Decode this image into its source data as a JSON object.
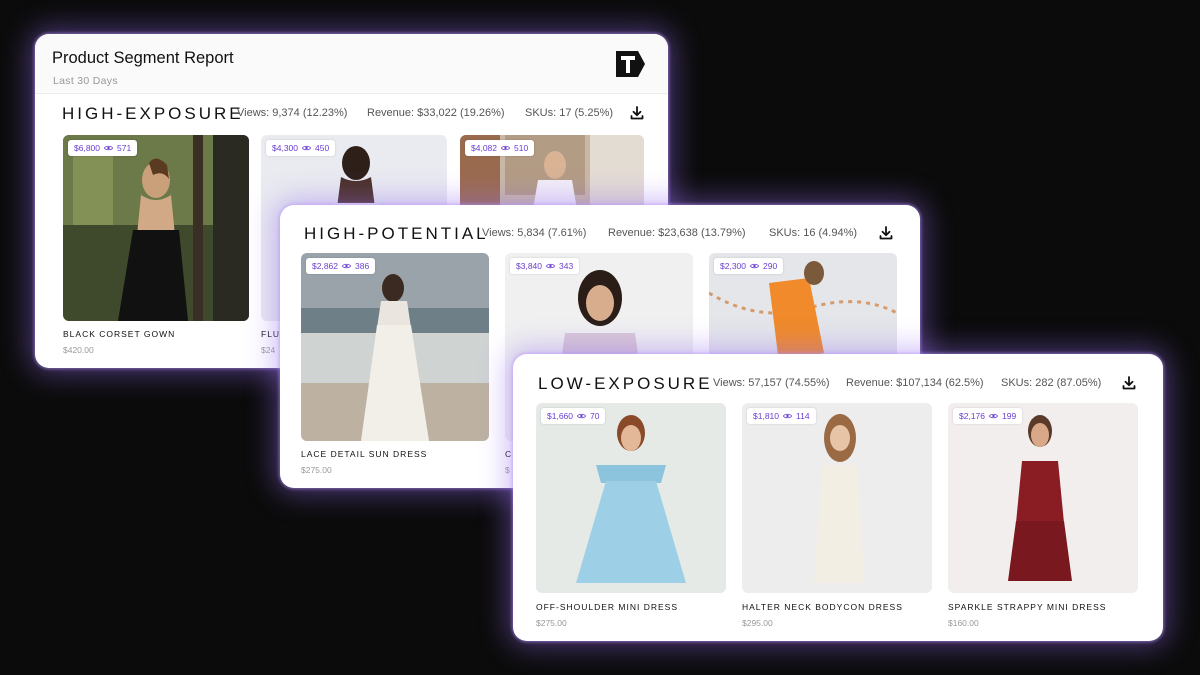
{
  "report": {
    "title": "Product Segment Report",
    "subtitle": "Last 30 Days",
    "logo_icon": "t-logo-icon"
  },
  "segments": {
    "high_exposure": {
      "title": "HIGH-EXPOSURE",
      "views": "Views: 9,374 (12.23%)",
      "revenue": "Revenue: $33,022 (19.26%)",
      "skus": "SKUs: 17 (5.25%)",
      "products": [
        {
          "name": "BLACK CORSET GOWN",
          "price": "$420.00",
          "revenue": "$6,800",
          "views": "571"
        },
        {
          "name": "FLU",
          "price": "$24",
          "revenue": "$4,300",
          "views": "450"
        },
        {
          "name": "",
          "price": "",
          "revenue": "$4,082",
          "views": "510"
        }
      ]
    },
    "high_potential": {
      "title": "HIGH-POTENTIAL",
      "views": "Views: 5,834 (7.61%)",
      "revenue": "Revenue: $23,638 (13.79%)",
      "skus": "SKUs: 16 (4.94%)",
      "products": [
        {
          "name": "LACE DETAIL SUN DRESS",
          "price": "$275.00",
          "revenue": "$2,862",
          "views": "386"
        },
        {
          "name": "C",
          "price": "$",
          "revenue": "$3,840",
          "views": "343"
        },
        {
          "name": "",
          "price": "",
          "revenue": "$2,300",
          "views": "290"
        }
      ]
    },
    "low_exposure": {
      "title": "LOW-EXPOSURE",
      "views": "Views: 57,157 (74.55%)",
      "revenue": "Revenue: $107,134 (62.5%)",
      "skus": "SKUs: 282 (87.05%)",
      "products": [
        {
          "name": "OFF-SHOULDER MINI DRESS",
          "price": "$275.00",
          "revenue": "$1,660",
          "views": "70"
        },
        {
          "name": "HALTER NECK BODYCON DRESS",
          "price": "$295.00",
          "revenue": "$1,810",
          "views": "114"
        },
        {
          "name": "SPARKLE STRAPPY MINI DRESS",
          "price": "$160.00",
          "revenue": "$2,176",
          "views": "199"
        }
      ]
    }
  },
  "colors": {
    "background": "#0b0b0b",
    "card_glow": "#966ef0",
    "badge_text": "#6a3fd0"
  }
}
